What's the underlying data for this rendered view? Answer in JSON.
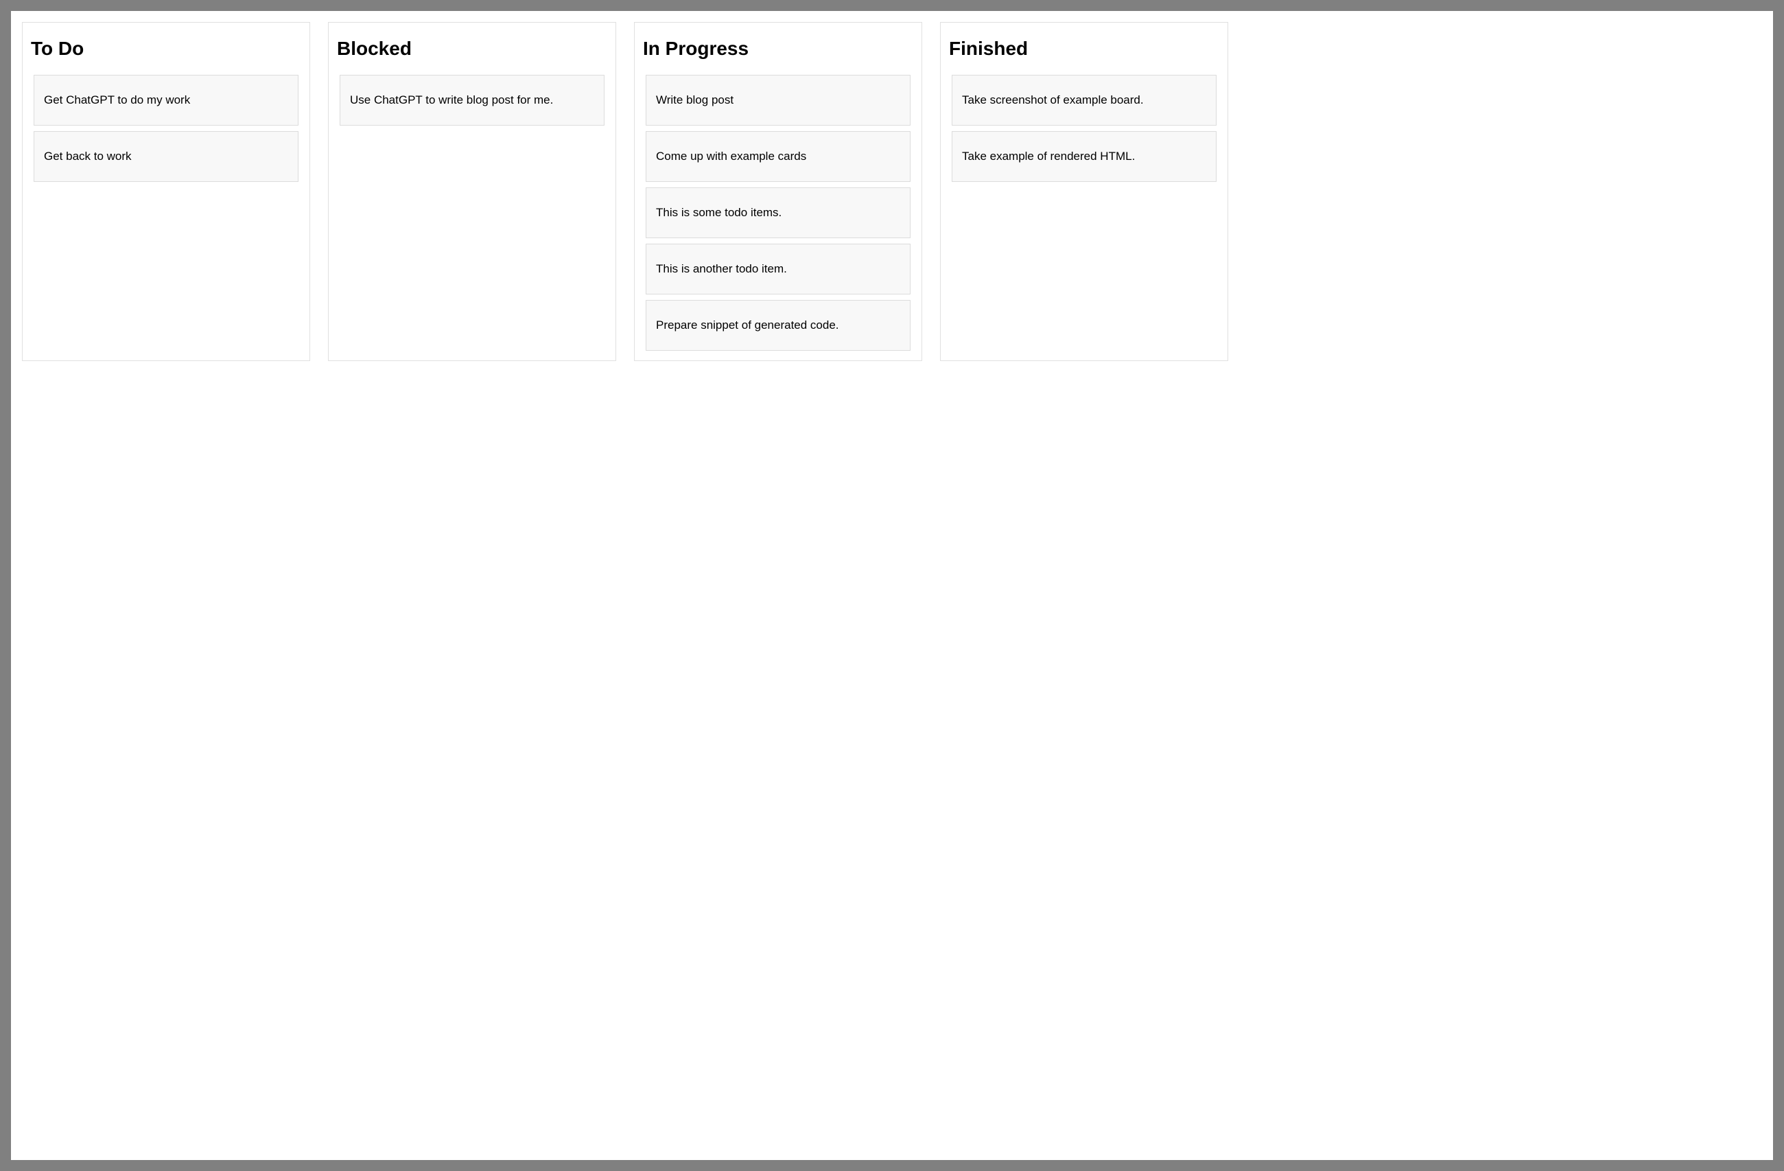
{
  "columns": [
    {
      "title": "To Do",
      "cards": [
        {
          "text": "Get ChatGPT to do my work"
        },
        {
          "text": "Get back to work"
        }
      ]
    },
    {
      "title": "Blocked",
      "cards": [
        {
          "text": "Use ChatGPT to write blog post for me."
        }
      ]
    },
    {
      "title": "In Progress",
      "cards": [
        {
          "text": "Write blog post"
        },
        {
          "text": "Come up with example cards"
        },
        {
          "text": "This is some todo items."
        },
        {
          "text": "This is another todo item."
        },
        {
          "text": "Prepare snippet of generated code."
        }
      ]
    },
    {
      "title": "Finished",
      "cards": [
        {
          "text": "Take screenshot of example board."
        },
        {
          "text": "Take example of rendered HTML."
        }
      ]
    }
  ]
}
